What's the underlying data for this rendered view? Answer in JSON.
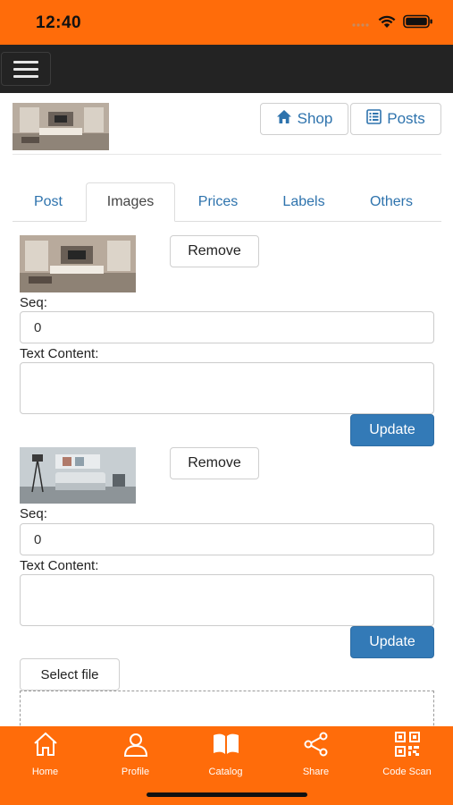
{
  "status_bar": {
    "time": "12:40"
  },
  "header": {
    "shop_label": "Shop",
    "posts_label": "Posts"
  },
  "tabs": [
    {
      "label": "Post",
      "active": false
    },
    {
      "label": "Images",
      "active": true
    },
    {
      "label": "Prices",
      "active": false
    },
    {
      "label": "Labels",
      "active": false
    },
    {
      "label": "Others",
      "active": false
    }
  ],
  "images": [
    {
      "remove_label": "Remove",
      "seq_label": "Seq:",
      "seq_value": "0",
      "text_label": "Text Content:",
      "text_value": "",
      "update_label": "Update"
    },
    {
      "remove_label": "Remove",
      "seq_label": "Seq:",
      "seq_value": "0",
      "text_label": "Text Content:",
      "text_value": "",
      "update_label": "Update"
    }
  ],
  "upload": {
    "select_label": "Select file"
  },
  "bottom_nav": [
    {
      "label": "Home",
      "icon": "home-icon"
    },
    {
      "label": "Profile",
      "icon": "user-icon"
    },
    {
      "label": "Catalog",
      "icon": "book-icon"
    },
    {
      "label": "Share",
      "icon": "share-icon"
    },
    {
      "label": "Code Scan",
      "icon": "qr-code-icon"
    }
  ],
  "colors": {
    "accent": "#ff6c0a",
    "navbar": "#232323",
    "link": "#2e73ad",
    "primary_button": "#337ab7"
  }
}
